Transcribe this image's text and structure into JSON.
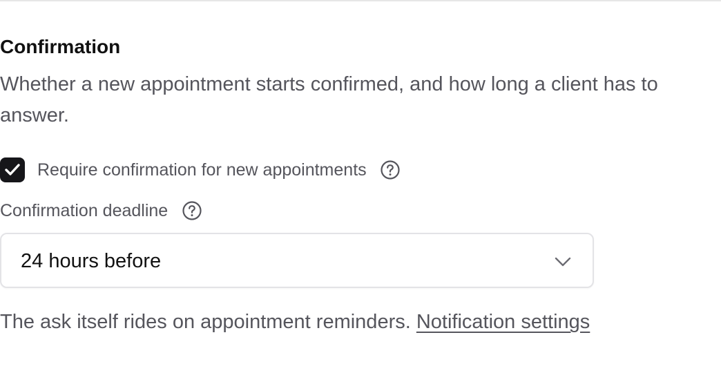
{
  "section": {
    "title": "Confirmation",
    "description": "Whether a new appointment starts confirmed, and how long a client has to answer."
  },
  "require_confirmation": {
    "label": "Require confirmation for new appointments",
    "checked": true,
    "help_icon": "question-circle-icon"
  },
  "deadline": {
    "label": "Confirmation deadline",
    "help_icon": "question-circle-icon",
    "selected_value": "24 hours before",
    "dropdown_icon": "chevron-down-icon"
  },
  "helper": {
    "text": "The ask itself rides on appointment reminders. ",
    "link_label": "Notification settings"
  },
  "colors": {
    "checkbox_fill": "#16161a",
    "muted_text": "#55555c",
    "border": "#e3e3e6"
  }
}
